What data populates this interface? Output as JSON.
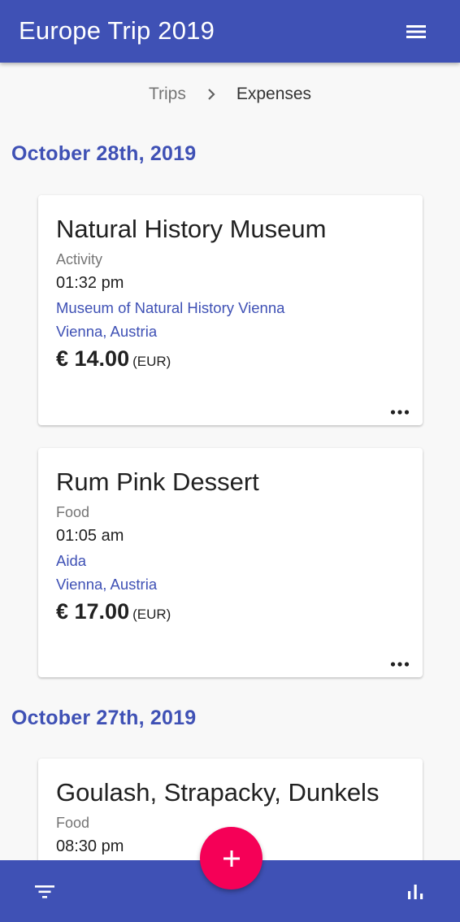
{
  "app": {
    "title": "Europe Trip 2019"
  },
  "breadcrumb": {
    "parent": "Trips",
    "current": "Expenses"
  },
  "colors": {
    "primary": "#3f51b5",
    "accent": "#f50057"
  },
  "groups": [
    {
      "date": "October 28th, 2019",
      "expenses": [
        {
          "title": "Natural History Museum",
          "category": "Activity",
          "time": "01:32 pm",
          "place": "Museum of Natural History Vienna",
          "location": "Vienna, Austria",
          "amount": "€ 14.00",
          "currency": "(EUR)"
        },
        {
          "title": "Rum Pink Dessert",
          "category": "Food",
          "time": "01:05 am",
          "place": "Aida",
          "location": "Vienna, Austria",
          "amount": "€ 17.00",
          "currency": "(EUR)"
        }
      ]
    },
    {
      "date": "October 27th, 2019",
      "expenses": [
        {
          "title": "Goulash, Strapacky, Dunkels",
          "category": "Food",
          "time": "08:30 pm"
        }
      ]
    }
  ],
  "icons": {
    "menu": "menu-icon",
    "chevron": "chevron-right-icon",
    "more": "more-horiz-icon",
    "filter": "filter-icon",
    "stats": "bar-chart-icon",
    "add": "plus-icon"
  }
}
